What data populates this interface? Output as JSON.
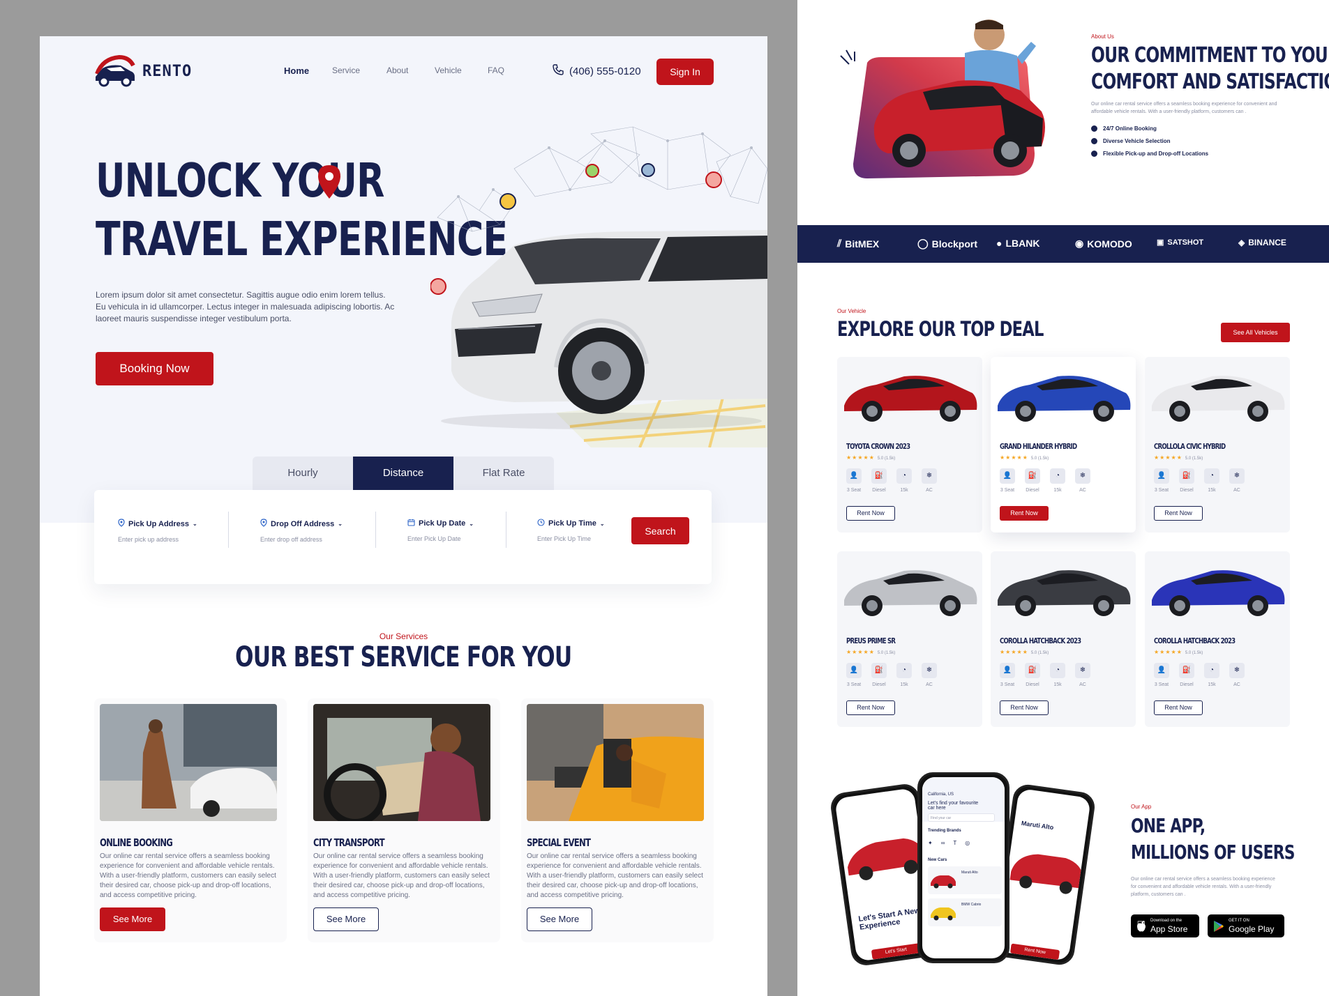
{
  "brand": {
    "name": "RENTO"
  },
  "nav": {
    "links": [
      "Home",
      "Service",
      "About",
      "Vehicle",
      "FAQ"
    ],
    "phone": "(406) 555-0120",
    "signin": "Sign In"
  },
  "hero": {
    "title_line1": "UNLOCK YOUR",
    "title_line2": "TRAVEL EXPERIENCE",
    "description": "Lorem ipsum dolor sit amet consectetur. Sagittis augue odio enim lorem tellus. Eu vehicula in id ullamcorper. Lectus integer in malesuada adipiscing lobortis. Ac laoreet mauris suspendisse integer vestibulum porta.",
    "cta": "Booking Now"
  },
  "search": {
    "tabs": [
      "Hourly",
      "Distance",
      "Flat Rate"
    ],
    "active_tab": "Distance",
    "fields": [
      {
        "label": "Pick Up Address",
        "placeholder": "Enter pick up address",
        "icon": "location-pin-icon"
      },
      {
        "label": "Drop Off Address",
        "placeholder": "Enter drop off address",
        "icon": "location-pin-icon"
      },
      {
        "label": "Pick Up Date",
        "placeholder": "Enter Pick Up Date",
        "icon": "calendar-icon"
      },
      {
        "label": "Pick Up Time",
        "placeholder": "Enter Pick Up Time",
        "icon": "clock-icon"
      }
    ],
    "button": "Search"
  },
  "services": {
    "eyebrow": "Our Services",
    "title": "OUR BEST SERVICE FOR YOU",
    "items": [
      {
        "title": "ONLINE BOOKING",
        "desc": "Our online car rental service offers a seamless booking experience for convenient and affordable vehicle rentals. With a user-friendly platform, customers can easily select their desired car, choose pick-up and drop-off locations, and access competitive pricing.",
        "button": "See More"
      },
      {
        "title": "CITY TRANSPORT",
        "desc": "Our online car rental service offers a seamless booking experience for convenient and affordable vehicle rentals. With a user-friendly platform, customers can easily select their desired car, choose pick-up and drop-off locations, and access competitive pricing.",
        "button": "See More"
      },
      {
        "title": "SPECIAL EVENT",
        "desc": "Our online car rental service offers a seamless booking experience for convenient and affordable vehicle rentals. With a user-friendly platform, customers can easily select their desired car, choose pick-up and drop-off locations, and access competitive pricing.",
        "button": "See More"
      }
    ]
  },
  "about": {
    "eyebrow": "About Us",
    "title_line1": "OUR COMMITMENT TO YOUR",
    "title_line2": "COMFORT AND SATISFACTION",
    "desc": "Our online car rental service offers a seamless booking experience for convenient and affordable vehicle rentals. With a user-friendly platform, customers can .",
    "checks": [
      "24/7 Online Booking",
      "Diverse Vehicle Selection",
      "Flexible Pick-up and Drop-off Locations"
    ]
  },
  "partners": [
    "BitMEX",
    "Blockport",
    "LBANK",
    "KOMODO",
    "SATSHOT",
    "BINANCE"
  ],
  "vehicles": {
    "eyebrow": "Our Vehicle",
    "title": "EXPLORE OUR TOP DEAL",
    "see_all": "See All Vehicles",
    "features": [
      "3 Seat",
      "Diesel",
      "15k",
      "AC"
    ],
    "cards": [
      {
        "name": "TOYOTA CROWN 2023",
        "rating": "★★★★★",
        "score": "5.0 (1.5k)",
        "button": "Rent Now",
        "color": "#b3151c"
      },
      {
        "name": "GRAND HILANDER HYBRID",
        "rating": "★★★★★",
        "score": "5.0 (1.5k)",
        "button": "Rent Now",
        "color": "#2547b8"
      },
      {
        "name": "CROLLOLA CIVIC HYBRID",
        "rating": "★★★★★",
        "score": "5.0 (1.5k)",
        "button": "Rent Now",
        "color": "#e9e9ec"
      },
      {
        "name": "PREUS PRIME SR",
        "rating": "★★★★★",
        "score": "5.0 (1.5k)",
        "button": "Rent Now",
        "color": "#bfc1c6"
      },
      {
        "name": "COROLLA HATCHBACK 2023",
        "rating": "★★★★★",
        "score": "5.0 (1.5k)",
        "button": "Rent Now",
        "color": "#3a3c42"
      },
      {
        "name": "COROLLA HATCHBACK 2023",
        "rating": "★★★★★",
        "score": "5.0 (1.5k)",
        "button": "Rent Now",
        "color": "#2a34b8"
      }
    ]
  },
  "app": {
    "eyebrow": "Our App",
    "title_line1": "ONE  APP,",
    "title_line2": "MILLIONS OF USERS",
    "desc": "Our online car rental service offers a seamless booking experience for convenient and affordable vehicle rentals. With a user-friendly platform, customers can .",
    "appstore_small": "Download on the",
    "appstore_big": "App Store",
    "gplay_small": "GET IT ON",
    "gplay_big": "Google Play",
    "phone_left": {
      "headline": "Let's Start A New Experience",
      "button": "Let's Start"
    },
    "phone_center": {
      "location": "California, US",
      "headline": "Let's find your favourite car here",
      "search_placeholder": "Find your car",
      "brands": "Trending Brands",
      "new_cars": "New Cars",
      "view_all": "View All",
      "car1": "Maruti Alto",
      "car2": "BMW Cabrio"
    },
    "phone_right": {
      "title": "Maruti Alto",
      "button": "Rent Now"
    }
  }
}
